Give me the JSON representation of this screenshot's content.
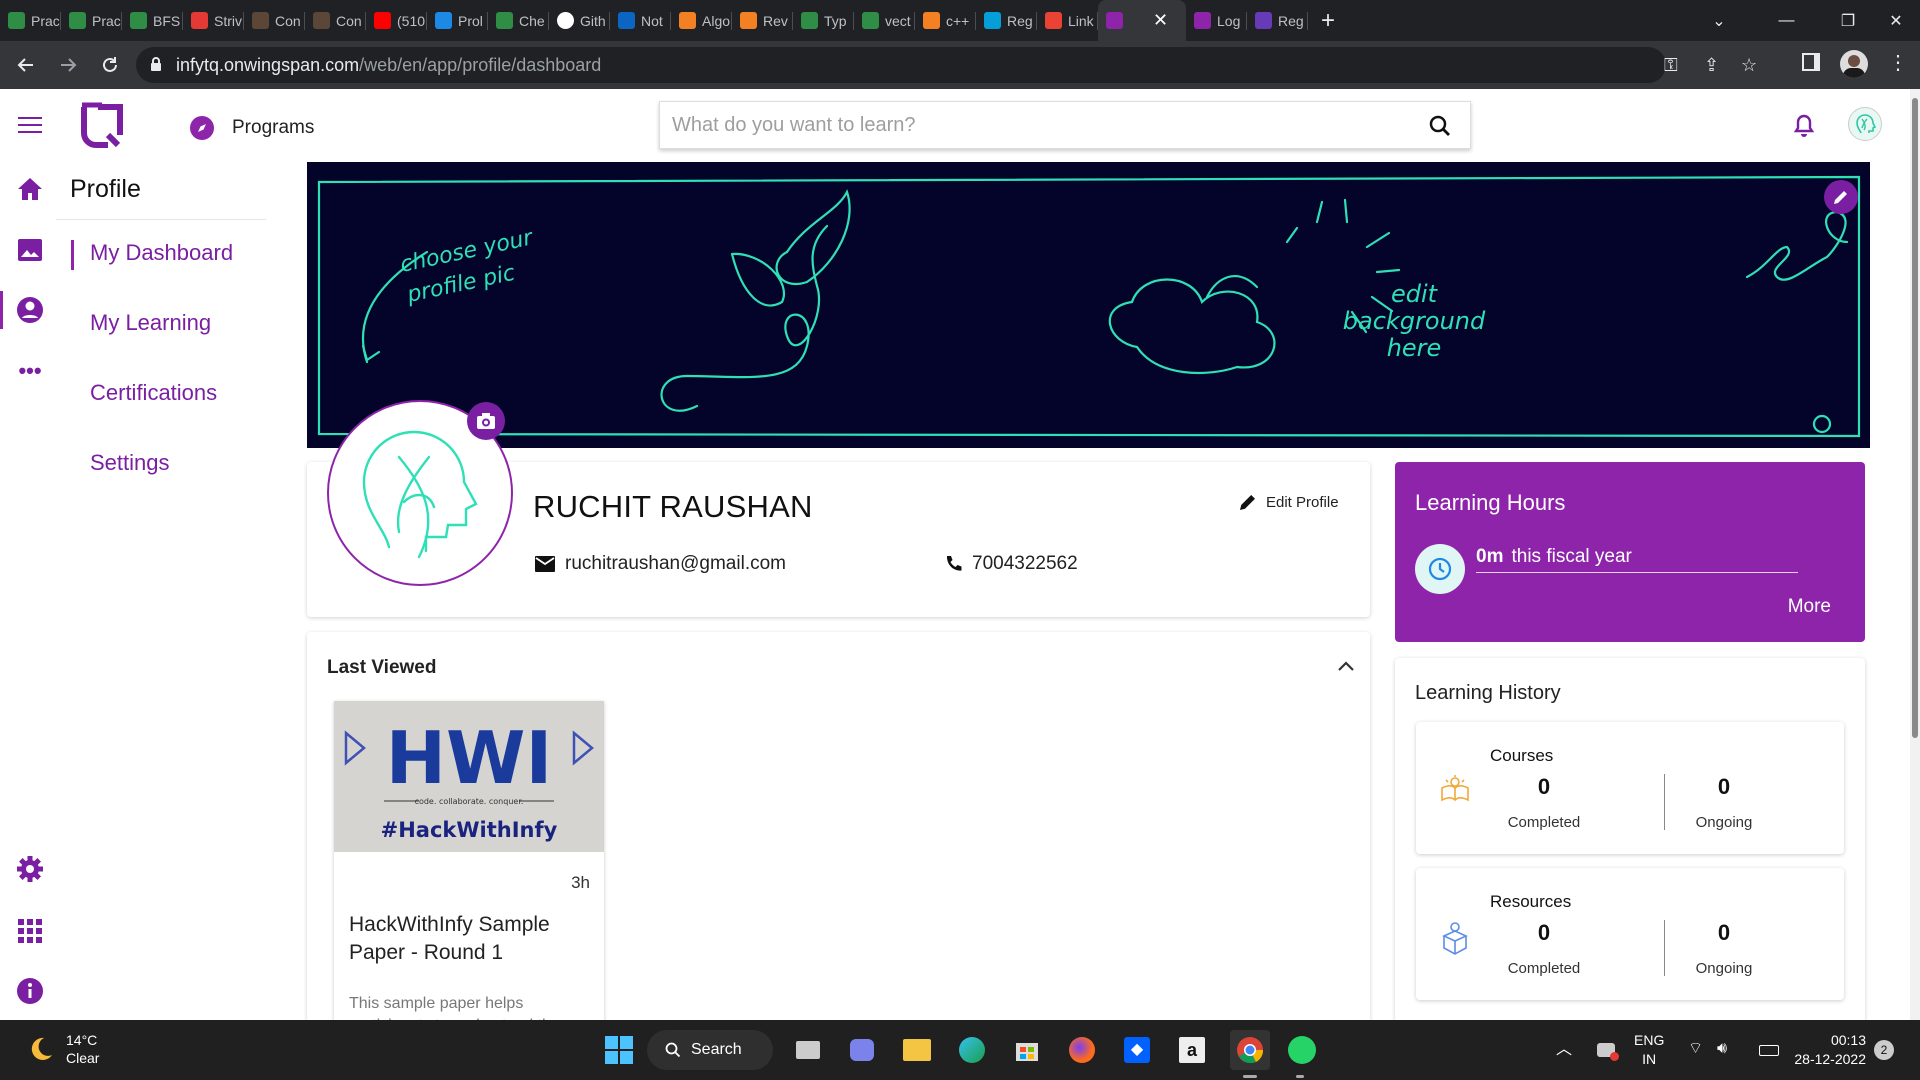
{
  "browser": {
    "tabs": [
      {
        "label": "Prac",
        "icon": "gfg-icon"
      },
      {
        "label": "Prac",
        "icon": "gfg-icon"
      },
      {
        "label": "BFS",
        "icon": "gfg-icon"
      },
      {
        "label": "Striv",
        "icon": "tuf-icon"
      },
      {
        "label": "Con",
        "icon": "codechef-icon"
      },
      {
        "label": "Con",
        "icon": "codechef-icon"
      },
      {
        "label": "(510",
        "icon": "youtube-icon"
      },
      {
        "label": "Prol",
        "icon": "chart-icon"
      },
      {
        "label": "Che",
        "icon": "gfg-icon"
      },
      {
        "label": "Gith",
        "icon": "github-icon"
      },
      {
        "label": "Not",
        "icon": "linkedin-icon"
      },
      {
        "label": "Algo",
        "icon": "stackoverflow-icon"
      },
      {
        "label": "Rev",
        "icon": "stackoverflow-icon"
      },
      {
        "label": "Typ",
        "icon": "gfg-icon"
      },
      {
        "label": "vect",
        "icon": "gfg-icon"
      },
      {
        "label": "c++",
        "icon": "stackoverflow-icon"
      },
      {
        "label": "Reg",
        "icon": "cisco-icon"
      },
      {
        "label": "Link",
        "icon": "gmail-icon"
      },
      {
        "label": "",
        "icon": "infytq-icon",
        "active": true
      },
      {
        "label": "Log",
        "icon": "infytq-icon"
      },
      {
        "label": "Reg",
        "icon": "forms-icon"
      }
    ],
    "url_host": "infytq.onwingspan.com",
    "url_path": "/web/en/app/profile/dashboard"
  },
  "header": {
    "programs_label": "Programs",
    "search_placeholder": "What do you want to learn?"
  },
  "sidebar": {
    "section_title": "Profile",
    "items": [
      {
        "label": "My Dashboard",
        "active": true
      },
      {
        "label": "My Learning"
      },
      {
        "label": "Certifications"
      },
      {
        "label": "Settings"
      }
    ]
  },
  "banner": {
    "choose_text_1": "choose your",
    "choose_text_2": "profile pic",
    "edit_text_1": "edit",
    "edit_text_2": "background",
    "edit_text_3": "here"
  },
  "profile": {
    "name": "RUCHIT RAUSHAN",
    "edit_label": "Edit Profile",
    "email": "ruchitraushan@gmail.com",
    "phone": "7004322562"
  },
  "learning_hours": {
    "title": "Learning Hours",
    "value": "0m",
    "period": "this fiscal year",
    "more_label": "More"
  },
  "last_viewed": {
    "title": "Last Viewed",
    "course": {
      "thumb_logo": "HWI",
      "thumb_tagline": "code. collaborate. conquer.",
      "thumb_hashtag": "#HackWithInfy",
      "duration": "3h",
      "title": "HackWithInfy Sample Paper - Round 1",
      "description": "This sample paper helps participants to understand the"
    }
  },
  "learning_history": {
    "title": "Learning History",
    "courses": {
      "label": "Courses",
      "completed": "0",
      "completed_label": "Completed",
      "ongoing": "0",
      "ongoing_label": "Ongoing"
    },
    "resources": {
      "label": "Resources",
      "completed": "0",
      "completed_label": "Completed",
      "ongoing": "0",
      "ongoing_label": "Ongoing"
    }
  },
  "taskbar": {
    "temperature": "14°C",
    "weather": "Clear",
    "search_label": "Search",
    "lang_1": "ENG",
    "lang_2": "IN",
    "time": "00:13",
    "date": "28-12-2022",
    "notification_count": "2"
  },
  "colors": {
    "brand_purple": "#8e24aa",
    "banner_bg": "#040329",
    "banner_line": "#2fe0b7",
    "taskbar": "#202020"
  }
}
